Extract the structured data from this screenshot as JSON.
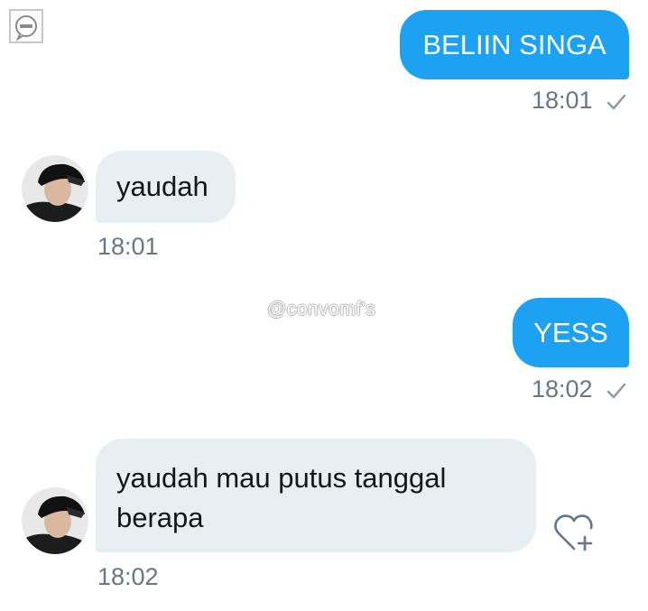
{
  "watermark": "@convomf's",
  "messages": [
    {
      "direction": "outgoing",
      "text": "BELIIN SINGA",
      "time": "18:01",
      "status_icon": "check-icon"
    },
    {
      "direction": "incoming",
      "text": "yaudah",
      "time": "18:01",
      "avatar": "avatar-photo"
    },
    {
      "direction": "outgoing",
      "text": "YESS",
      "time": "18:02",
      "status_icon": "check-icon"
    },
    {
      "direction": "incoming",
      "text_lines": [
        "yaudah mau putus tanggal",
        "berapa"
      ],
      "time": "18:02",
      "avatar": "avatar-photo",
      "action_icon": "heart-plus-icon"
    }
  ],
  "colors": {
    "outgoing_bubble": "#1da1f2",
    "incoming_bubble": "#e8eff3",
    "timestamp": "#657786"
  }
}
